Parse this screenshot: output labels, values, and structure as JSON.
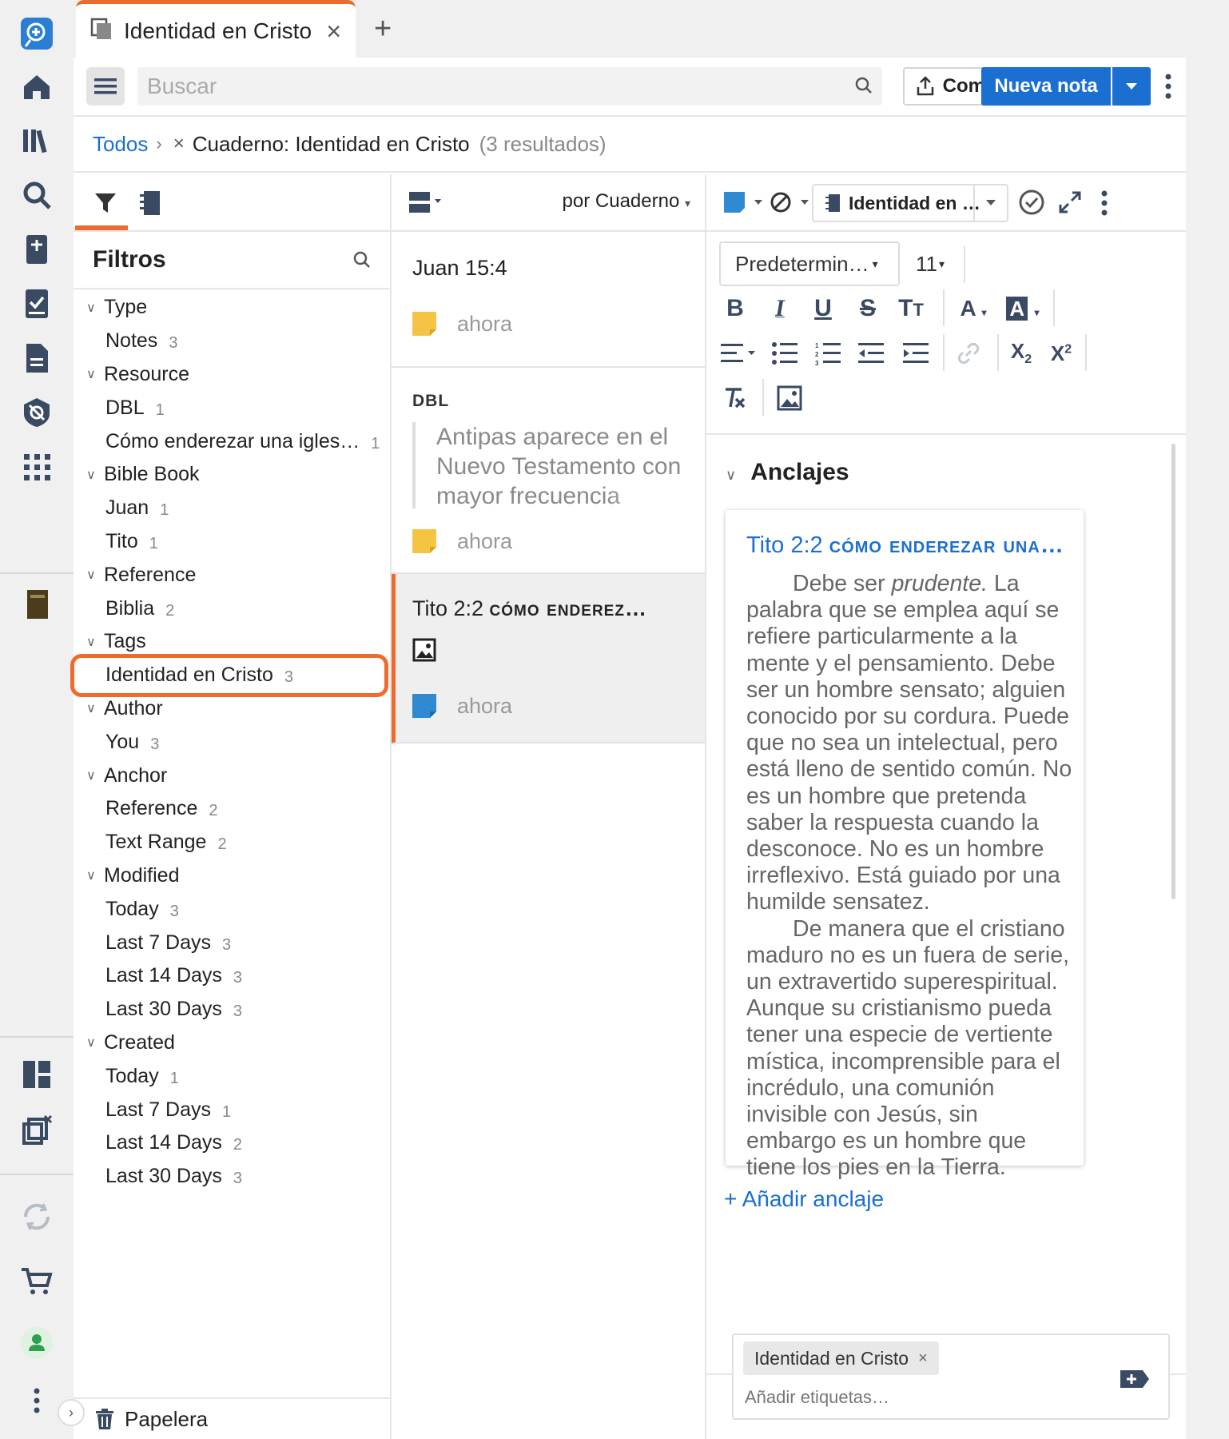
{
  "app": {
    "accent": "#ee6b2d",
    "link_color": "#1a6fd1"
  },
  "tab": {
    "title": "Identidad en Cristo",
    "close": "×",
    "new_tab": "+"
  },
  "rail": {
    "icons": [
      "logos-app-icon",
      "home-icon",
      "library-icon",
      "search-icon",
      "bible-add-icon",
      "checklist-icon",
      "document-icon",
      "shield-eye-icon",
      "apps-grid-icon",
      "book-cover-icon",
      "layout-icon",
      "close-panels-icon",
      "sync-icon",
      "cart-icon",
      "user-icon",
      "more-vertical-icon"
    ]
  },
  "toolbar": {
    "search_placeholder": "Buscar",
    "share_label": "Compartir",
    "new_note_label": "Nueva nota"
  },
  "breadcrumb": {
    "all": "Todos",
    "chevron": "›",
    "remove": "×",
    "notebook": "Cuaderno: Identidad en Cristo",
    "count": "(3 resultados)"
  },
  "filters": {
    "title": "Filtros",
    "groups": [
      {
        "label": "Type",
        "items": [
          {
            "label": "Notes",
            "count": "3"
          }
        ]
      },
      {
        "label": "Resource",
        "items": [
          {
            "label": "DBL",
            "count": "1"
          },
          {
            "label": "Cómo enderezar una igles…",
            "count": "1"
          }
        ]
      },
      {
        "label": "Bible Book",
        "items": [
          {
            "label": "Juan",
            "count": "1"
          },
          {
            "label": "Tito",
            "count": "1"
          }
        ]
      },
      {
        "label": "Reference",
        "items": [
          {
            "label": "Biblia",
            "count": "2"
          }
        ]
      },
      {
        "label": "Tags",
        "items": [
          {
            "label": "Identidad en Cristo",
            "count": "3"
          }
        ]
      },
      {
        "label": "Author",
        "items": [
          {
            "label": "You",
            "count": "3"
          }
        ]
      },
      {
        "label": "Anchor",
        "items": [
          {
            "label": "Reference",
            "count": "2"
          },
          {
            "label": "Text Range",
            "count": "2"
          }
        ]
      },
      {
        "label": "Modified",
        "items": [
          {
            "label": "Today",
            "count": "3"
          },
          {
            "label": "Last 7 Days",
            "count": "3"
          },
          {
            "label": "Last 14 Days",
            "count": "3"
          },
          {
            "label": "Last 30 Days",
            "count": "3"
          }
        ]
      },
      {
        "label": "Created",
        "items": [
          {
            "label": "Today",
            "count": "1"
          },
          {
            "label": "Last 7 Days",
            "count": "1"
          },
          {
            "label": "Last 14 Days",
            "count": "2"
          },
          {
            "label": "Last 30 Days",
            "count": "3"
          }
        ]
      }
    ],
    "trash": "Papelera"
  },
  "notes": {
    "sort_label": "por Cuaderno",
    "items": [
      {
        "title": "Juan 15:4",
        "time": "ahora"
      },
      {
        "resource": "DBL",
        "quote": "Antipas aparece en el Nuevo Testamento con mayor frecuencia",
        "time": "ahora"
      },
      {
        "title_ref": "Tito 2:2 ",
        "title_sc": "cómo enderez…",
        "time": "ahora"
      }
    ]
  },
  "editor": {
    "notebook": "Identidad en …",
    "font": "Predetermin…",
    "font_size": "11",
    "anchors_title": "Anclajes",
    "anchor": {
      "ref": "Tito 2:2 ",
      "resource_sc": "cómo enderezar una…",
      "p1_a": "Debe ser ",
      "p1_em": "prudente.",
      "p1_b": " La palabra que se emplea aquí se refiere particularmente a la mente y el pensamiento. Debe ser un hombre sensato; alguien conocido por su cordura. Puede que no sea un intelectual, pero está lleno de sentido común. No es un hombre que pretenda saber la respuesta cuando la desconoce. No es un hombre irreflexivo. Está guiado por una humilde sensatez.",
      "p2": "De manera que el cristiano maduro no es un fuera de serie, un extravertido superespiritual. Aunque su cristianismo pueda tener una especie de vertiente mística, incomprensible para el incrédulo, una comunión invisible con Jesús, sin embargo es un hombre que tiene los pies en la Tierra."
    },
    "add_anchor": "+ Añadir anclaje",
    "tag": "Identidad en Cristo",
    "tag_remove": "×",
    "tag_placeholder": "Añadir etiquetas…"
  }
}
